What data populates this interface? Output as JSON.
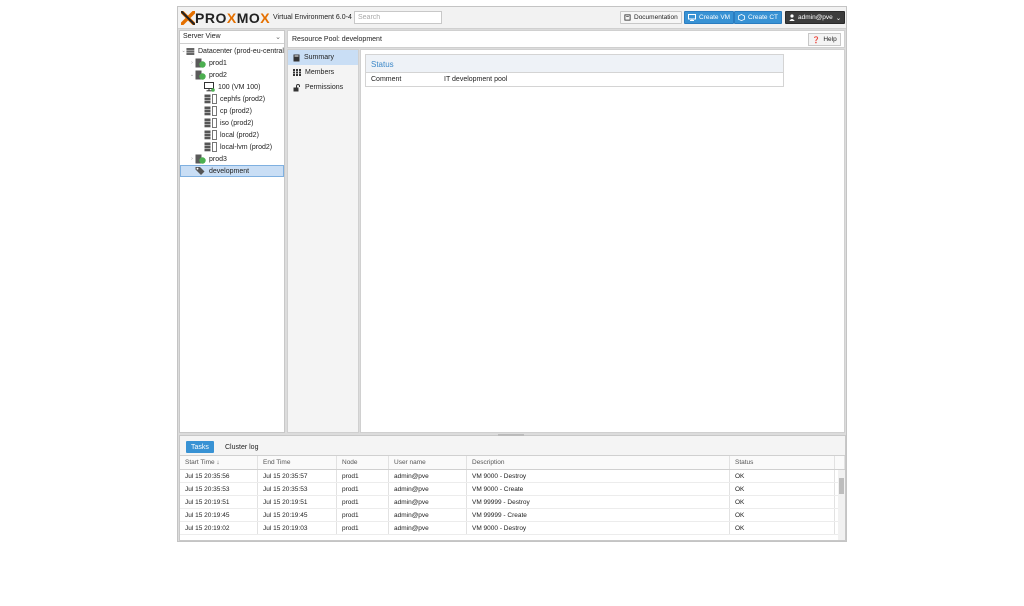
{
  "header": {
    "logo_text_a": "PRO",
    "logo_text_x": "X",
    "logo_text_b": "MO",
    "logo_text_x2": "X",
    "version": "Virtual Environment 6.0-4",
    "search_placeholder": "Search",
    "documentation_label": "Documentation",
    "create_vm_label": "Create VM",
    "create_ct_label": "Create CT",
    "user_label": "admin@pve"
  },
  "sidebar": {
    "view_label": "Server View",
    "tree": [
      {
        "label": "Datacenter (prod-eu-central",
        "icon": "datacenter-icon",
        "depth": 0
      },
      {
        "label": "prod1",
        "icon": "node-icon",
        "depth": 1
      },
      {
        "label": "prod2",
        "icon": "node-icon",
        "depth": 1
      },
      {
        "label": "100 (VM 100)",
        "icon": "vm-icon",
        "depth": 2
      },
      {
        "label": "cephfs (prod2)",
        "icon": "storage-icon",
        "depth": 2
      },
      {
        "label": "cp (prod2)",
        "icon": "storage-icon",
        "depth": 2
      },
      {
        "label": "iso (prod2)",
        "icon": "storage-icon",
        "depth": 2
      },
      {
        "label": "local (prod2)",
        "icon": "storage-icon",
        "depth": 2
      },
      {
        "label": "local-lvm (prod2)",
        "icon": "storage-icon",
        "depth": 2
      },
      {
        "label": "prod3",
        "icon": "node-icon",
        "depth": 1
      },
      {
        "label": "development",
        "icon": "pool-icon",
        "depth": 1
      }
    ]
  },
  "content": {
    "title": "Resource Pool: development",
    "help_label": "Help",
    "menu": [
      {
        "label": "Summary",
        "icon": "book-icon"
      },
      {
        "label": "Members",
        "icon": "grid-icon"
      },
      {
        "label": "Permissions",
        "icon": "unlock-icon"
      }
    ],
    "status_title": "Status",
    "comment_label": "Comment",
    "comment_value": "IT development pool"
  },
  "tasks": {
    "tabs": [
      "Tasks",
      "Cluster log"
    ],
    "columns": [
      "Start Time ↓",
      "End Time",
      "Node",
      "User name",
      "Description",
      "Status"
    ],
    "rows": [
      [
        "Jul 15 20:35:56",
        "Jul 15 20:35:57",
        "prod1",
        "admin@pve",
        "VM 9000 - Destroy",
        "OK"
      ],
      [
        "Jul 15 20:35:53",
        "Jul 15 20:35:53",
        "prod1",
        "admin@pve",
        "VM 9000 - Create",
        "OK"
      ],
      [
        "Jul 15 20:19:51",
        "Jul 15 20:19:51",
        "prod1",
        "admin@pve",
        "VM 99999 - Destroy",
        "OK"
      ],
      [
        "Jul 15 20:19:45",
        "Jul 15 20:19:45",
        "prod1",
        "admin@pve",
        "VM 99999 - Create",
        "OK"
      ],
      [
        "Jul 15 20:19:02",
        "Jul 15 20:19:03",
        "prod1",
        "admin@pve",
        "VM 9000 - Destroy",
        "OK"
      ]
    ]
  },
  "colors": {
    "accent": "#3892d4",
    "brand_orange": "#e57000",
    "selection": "#c9def5"
  }
}
